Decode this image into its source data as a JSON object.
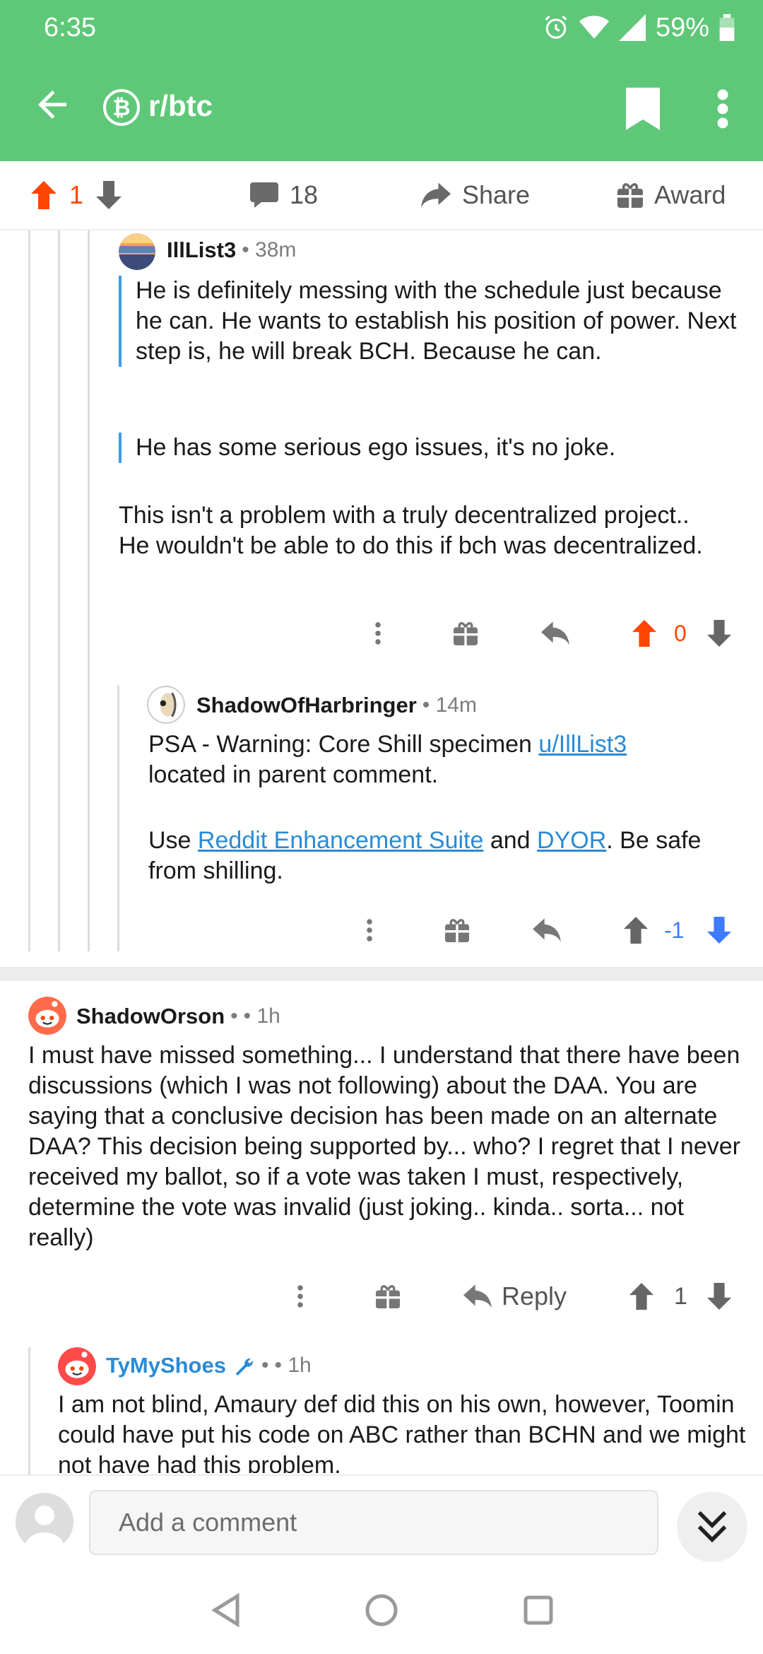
{
  "status_bar": {
    "time": "6:35",
    "battery": "59%"
  },
  "app_bar": {
    "subreddit": "r/btc"
  },
  "post_actions": {
    "score": "1",
    "comments": "18",
    "share_label": "Share",
    "award_label": "Award"
  },
  "comments": [
    {
      "author": "IllList3",
      "age": "• 38m",
      "quote1": "He is definitely messing with the schedule just because he can. He wants to establish his position of power. Next step is, he will break BCH. Because he can.",
      "quote2": "He has some serious ego issues, it's no joke.",
      "text": "This isn't a problem with a truly decentralized project..  He wouldn't be able to do this if bch was decentralized.",
      "score": "0"
    },
    {
      "author": "ShadowOfHarbringer",
      "age": "• 14m",
      "line1_prefix": "PSA - Warning: Core Shill specimen ",
      "line1_link": "u/IllList3",
      "line1_suffix": "located in parent comment.",
      "line2_prefix": "Use ",
      "line2_link1": "Reddit Enhancement Suite",
      "line2_mid": " and ",
      "line2_link2": "DYOR",
      "line2_suffix": ". Be safe from shilling.",
      "score": "-1"
    },
    {
      "author": "ShadowOrson",
      "age": "• 1h",
      "text": "I must have missed something... I understand that there have been discussions (which I was not following) about the DAA. You are saying that a conclusive decision has been made on an alternate DAA? This decision being supported by... who? I regret that I never received my ballot, so if a vote was taken I must, respectively, determine the vote was invalid (just joking.. kinda.. sorta... not really)",
      "reply_label": "Reply",
      "score": "1"
    },
    {
      "author": "TyMyShoes",
      "age": "• 1h",
      "text": "I am not blind, Amaury def did this on his own, however, Toomin could have put his code on ABC rather than BCHN and we might not have had this problem."
    }
  ],
  "comment_bar": {
    "placeholder": "Add a comment"
  },
  "colors": {
    "header": "#5ec878",
    "upvote": "#ff4500",
    "downvote": "#3d7bff",
    "link": "#2a8bd5",
    "quote": "#3d9be9"
  }
}
